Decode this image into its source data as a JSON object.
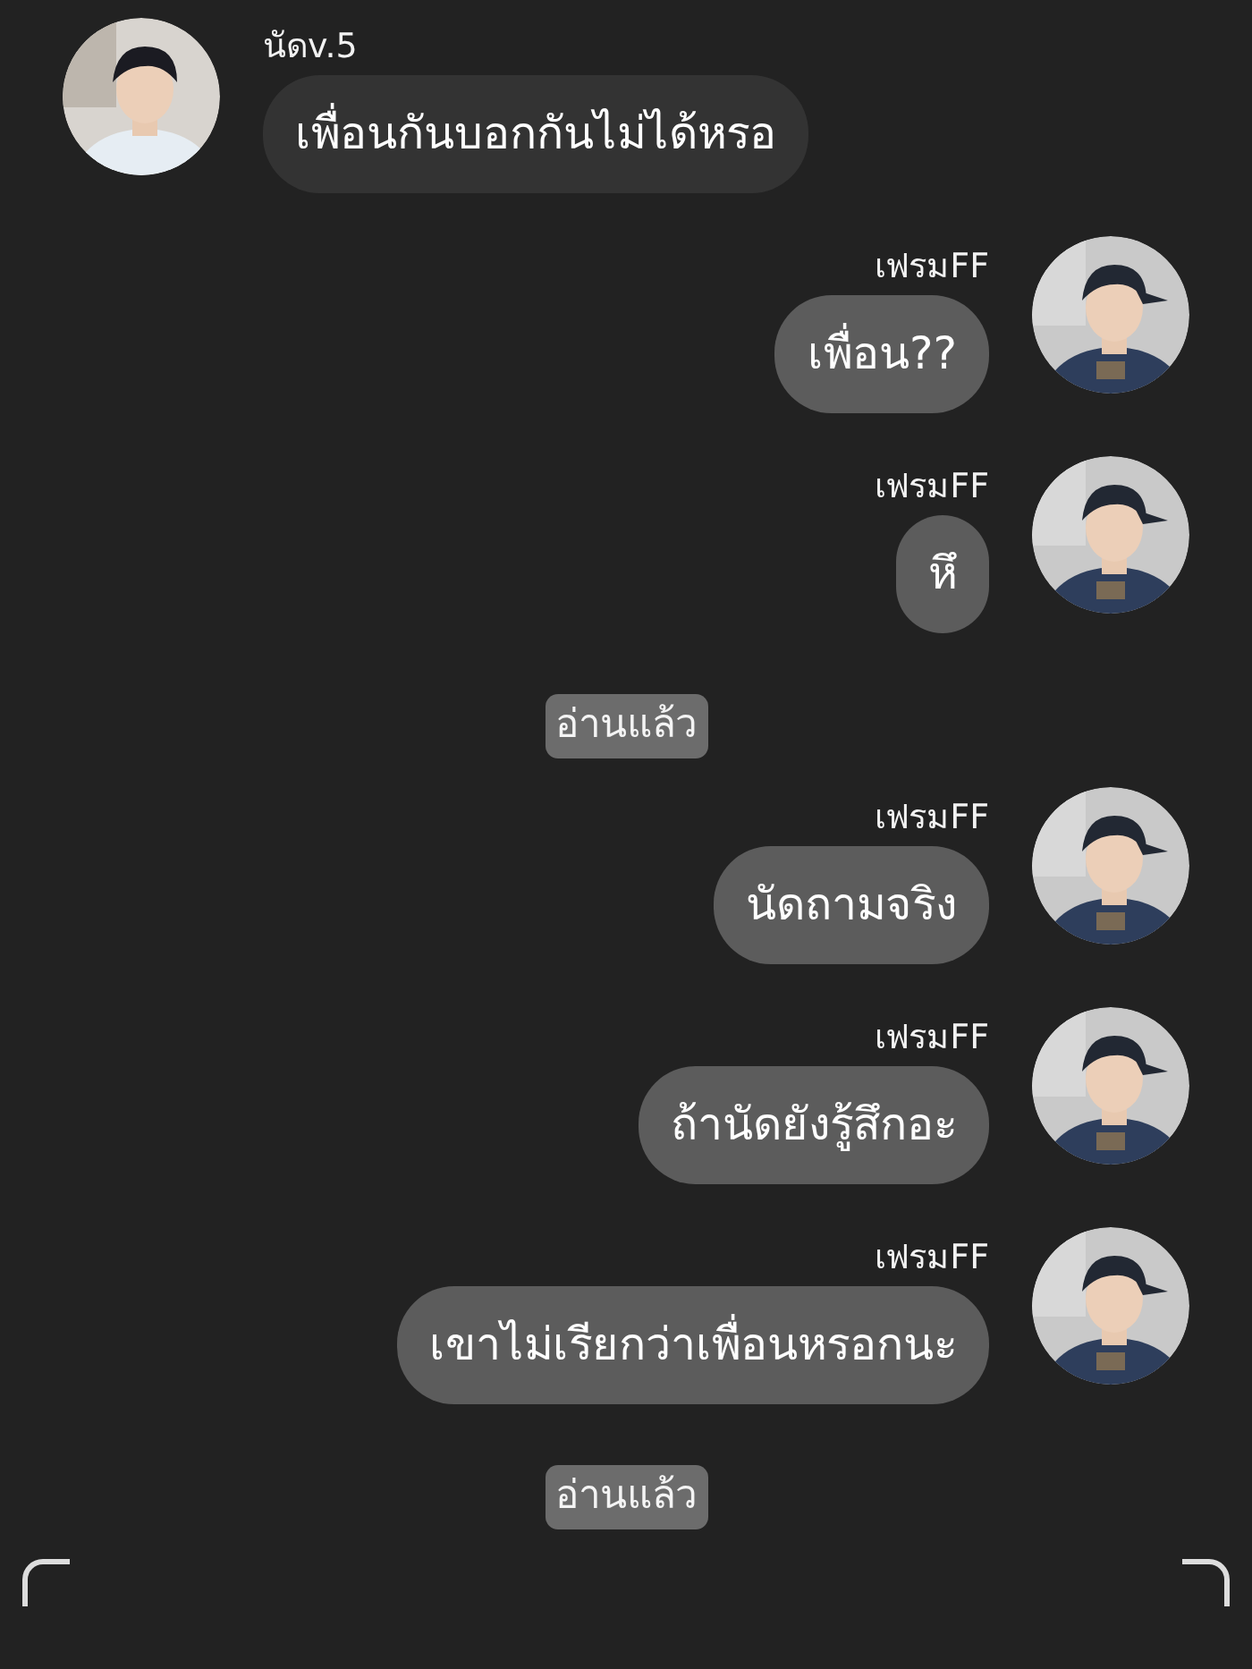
{
  "messages": [
    {
      "kind": "incoming",
      "sender": "นัดv.5",
      "text": "เพื่อนกันบอกกันไม่ได้หรอ"
    },
    {
      "kind": "outgoing",
      "sender": "เฟรมFF",
      "text": "เพื่อน??"
    },
    {
      "kind": "outgoing",
      "sender": "เฟรมFF",
      "text": "หึ"
    },
    {
      "kind": "read",
      "text": "อ่านแล้ว"
    },
    {
      "kind": "outgoing",
      "sender": "เฟรมFF",
      "text": "นัดถามจริง"
    },
    {
      "kind": "outgoing",
      "sender": "เฟรมFF",
      "text": "ถ้านัดยังรู้สึกอะ"
    },
    {
      "kind": "outgoing",
      "sender": "เฟรมFF",
      "text": "เขาไม่เรียกว่าเพื่อนหรอกนะ"
    },
    {
      "kind": "read",
      "text": "อ่านแล้ว"
    }
  ]
}
